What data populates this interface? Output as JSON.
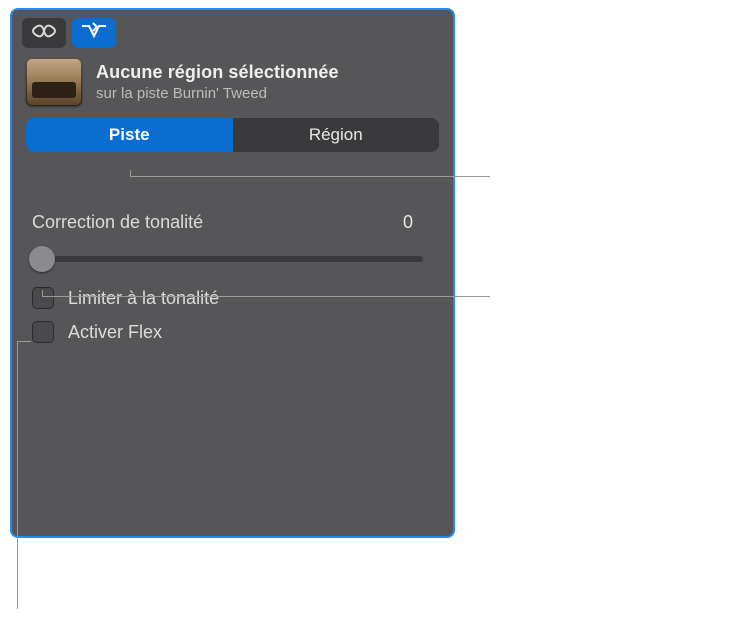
{
  "header": {
    "title": "Aucune région sélectionnée",
    "subtitle": "sur la piste Burnin' Tweed"
  },
  "tabs": {
    "piste": "Piste",
    "region": "Région"
  },
  "pitch": {
    "label": "Correction de tonalité",
    "value": "0"
  },
  "checks": {
    "limitKey": "Limiter à la tonalité",
    "enableFlex": "Activer Flex"
  },
  "icons": {
    "loop": "loop-icon",
    "filter": "filter-routing-icon"
  }
}
